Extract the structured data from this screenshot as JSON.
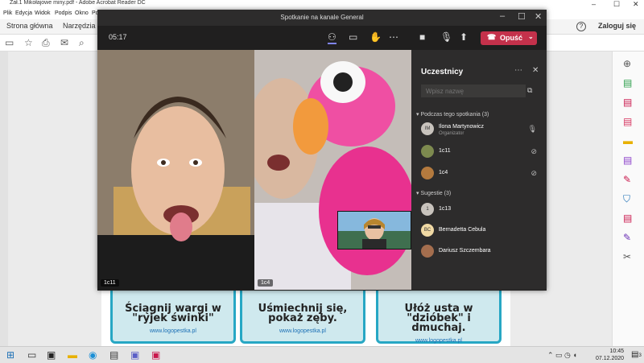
{
  "acrobat": {
    "title": "Zał.1 Mikołajowe miny.pdf - Adobe Acrobat Reader DC",
    "menu": [
      "Plik",
      "Edycja",
      "Widok",
      "Podpis",
      "Okno",
      "Po"
    ],
    "tabs": {
      "home": "Strona główna",
      "tools": "Narzędzia"
    },
    "help_icon": "?",
    "login": "Zaloguj się",
    "cards": [
      {
        "text": "Ściągnij wargi w \"ryjek świnki\"",
        "url": "www.logopestka.pl"
      },
      {
        "text": "Uśmiechnij się, pokaż zęby.",
        "url": "www.logopestka.pl"
      },
      {
        "text": "Ułóż usta w \"dzióbek\" i dmuchaj.",
        "url": "www.logopestka.pl"
      }
    ]
  },
  "teams": {
    "title": "Spotkanie na kanale General",
    "timer": "05:17",
    "leave_label": "Opuść",
    "videos": [
      {
        "label": "1c11"
      },
      {
        "label": "1c4"
      }
    ],
    "panel": {
      "header": "Uczestnicy",
      "search_placeholder": "Wpisz nazwę",
      "in_meeting_header": "Podczas tego spotkania (3)",
      "suggestions_header": "Sugestie (3)",
      "in_meeting": [
        {
          "initials": "IM",
          "name": "Ilona Martynowicz",
          "role": "Organizator",
          "mic": "on",
          "color": "#c8c3bd"
        },
        {
          "initials": "",
          "name": "1c11",
          "role": "",
          "mic": "muted",
          "color": "#7d8a4f"
        },
        {
          "initials": "",
          "name": "1c4",
          "role": "",
          "mic": "muted",
          "color": "#b47a3e"
        }
      ],
      "suggestions": [
        {
          "initials": "1",
          "name": "1c13",
          "color": "#c8c3bd"
        },
        {
          "initials": "BC",
          "name": "Bernadetta Cebula",
          "color": "#f0d9a4"
        },
        {
          "initials": "",
          "name": "Dariusz Szczembara",
          "color": "#a46e4e"
        }
      ]
    }
  },
  "taskbar": {
    "time": "10:45",
    "date": "07.12.2020",
    "notifications": "3"
  },
  "colors": {
    "leave": "#c4314b",
    "teams_bg": "#201f1f",
    "card_border": "#27a7c4"
  }
}
